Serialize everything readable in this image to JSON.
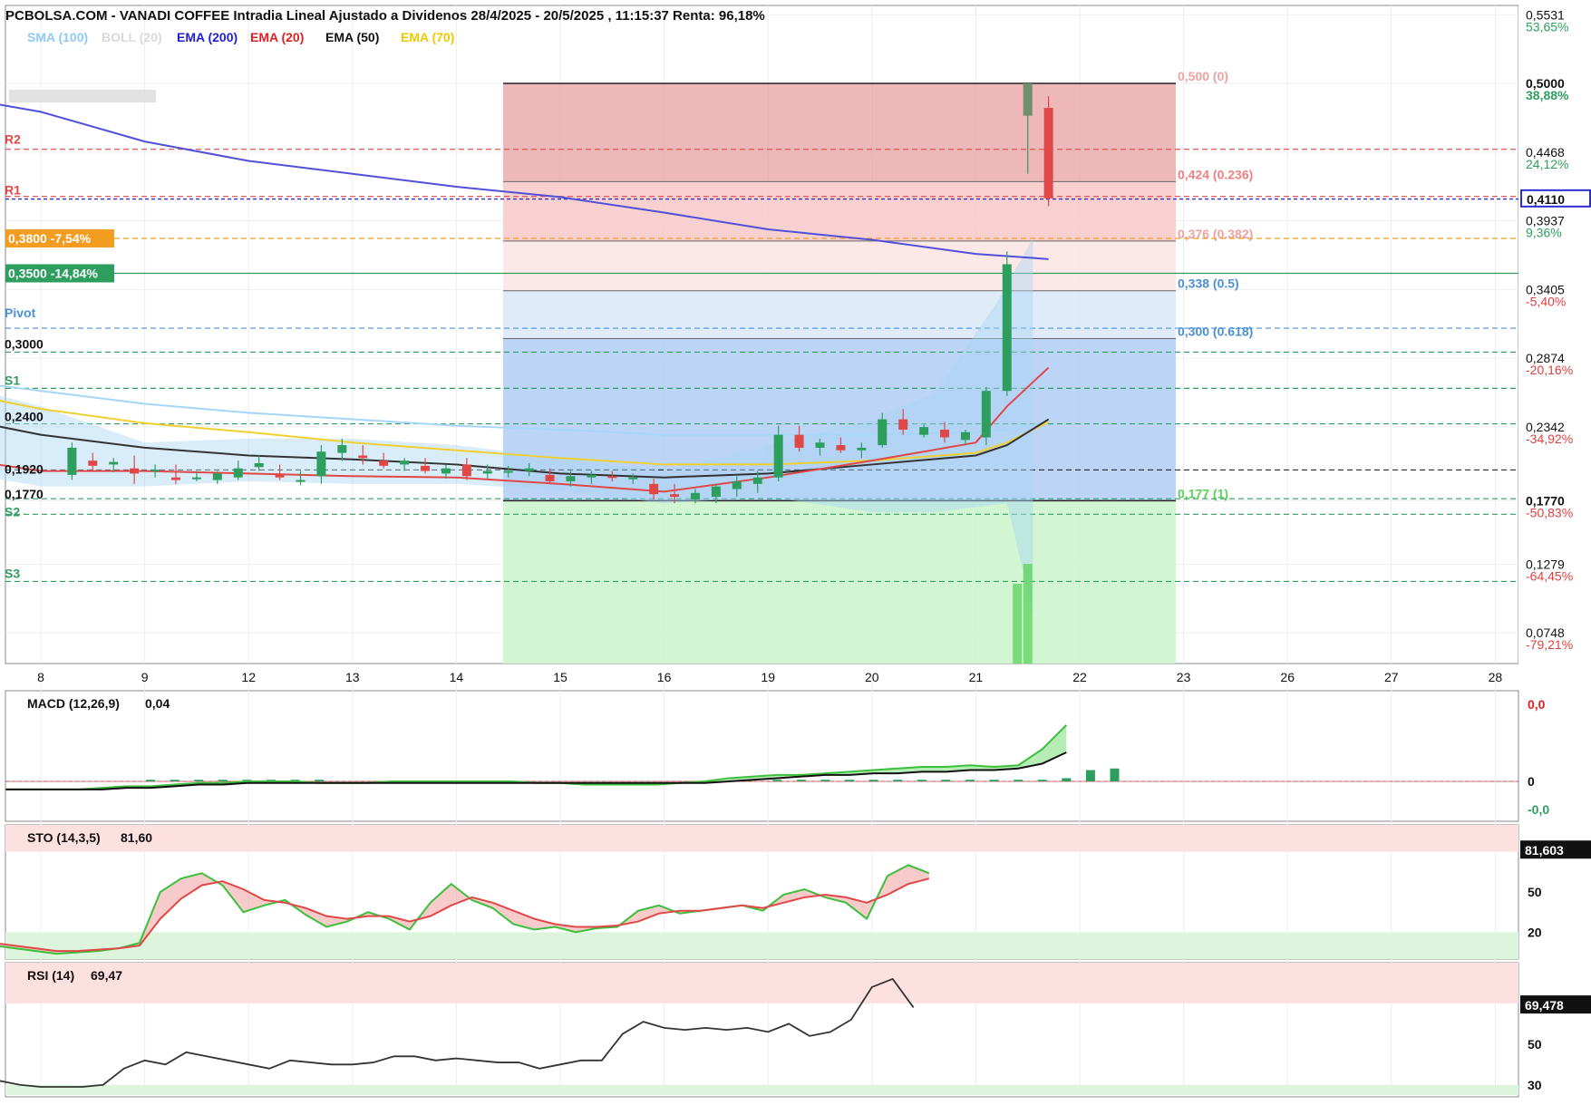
{
  "header": {
    "title": "PCBOLSA.COM - VANADI COFFEE Intradia Lineal Ajustado a Dividenos 28/4/2025 - 20/5/2025 , 11:15:37 Renta: 96,18%",
    "legend": [
      {
        "label": "SMA (100)",
        "color": "#8ec9f5"
      },
      {
        "label": "BOLL (20)",
        "color": "#d8d8d8"
      },
      {
        "label": "EMA (200)",
        "color": "#1f1fd8"
      },
      {
        "label": "EMA (20)",
        "color": "#e02020"
      },
      {
        "label": "EMA (50)",
        "color": "#111111"
      },
      {
        "label": "EMA (70)",
        "color": "#f0c800"
      }
    ]
  },
  "price_axis": {
    "ticks": [
      "0,5531",
      "0,5000",
      "0,4468",
      "0,3937",
      "0,3405",
      "0,2874",
      "0,2342",
      "0,1770",
      "0,1279",
      "0,0748"
    ],
    "ticks_num": [
      0.5531,
      0.5,
      0.4468,
      0.3937,
      0.3405,
      0.2874,
      0.2342,
      0.177,
      0.1279,
      0.0748
    ],
    "percents": [
      "53,65%",
      "38,88%",
      "24,12%",
      "9,36%",
      "-5,40%",
      "-20,16%",
      "-34,92%",
      "-50,83%",
      "-64,45%",
      "-79,21%"
    ],
    "percent_colors": [
      "#2e9e5e",
      "#2e9e5e",
      "#2e9e5e",
      "#2e9e5e",
      "#e04040",
      "#e04040",
      "#e04040",
      "#e04040",
      "#e04040",
      "#e04040"
    ],
    "current_price": "0,4110",
    "current_value": 0.411,
    "range": [
      0.04,
      0.575
    ]
  },
  "x_axis": {
    "labels": [
      "8",
      "9",
      "12",
      "13",
      "14",
      "15",
      "16",
      "19",
      "20",
      "21",
      "22",
      "23",
      "26",
      "27",
      "28"
    ]
  },
  "levels": {
    "r2": {
      "label": "R2",
      "value": 0.449
    },
    "r1": {
      "label": "R1",
      "value": 0.4125
    },
    "pivot": {
      "label": "Pivot",
      "value": 0.3105
    },
    "pivot_value": {
      "label": "0,3000",
      "value": 0.292
    },
    "s1": {
      "label": "S1",
      "value": 0.264
    },
    "s1_value": {
      "label": "0,2400",
      "value": 0.2365
    },
    "s2": {
      "label": "S2",
      "value": 0.1665
    },
    "s2_value": {
      "label": "0,1770",
      "value": 0.1785
    },
    "s3": {
      "label": "S3",
      "value": 0.1145
    },
    "left_0192": {
      "label": "0,1920",
      "value": 0.2065
    }
  },
  "alerts": [
    {
      "label": "0,3800 -7,54%",
      "value": 0.38,
      "color": "#f39c1f"
    },
    {
      "label": "0,3500 -14,84%",
      "value": 0.353,
      "color": "#2e9e5e"
    }
  ],
  "fibonacci": {
    "levels": [
      {
        "label": "0,500 (0)",
        "value": 0.5,
        "color": "#f0a0a0"
      },
      {
        "label": "0,424 (0.236)",
        "value": 0.424,
        "color": "#f08080"
      },
      {
        "label": "0,376 (0.382)",
        "value": 0.378,
        "color": "#f0a0a0"
      },
      {
        "label": "0,338 (0.5)",
        "value": 0.3395,
        "color": "#4a90d9"
      },
      {
        "label": "0,300 (0.618)",
        "value": 0.3025,
        "color": "#4a90d9"
      },
      {
        "label": "0,177 (1)",
        "value": 0.177,
        "color": "#5ad35a"
      }
    ]
  },
  "indicators": {
    "macd": {
      "title": "MACD (12,26,9)",
      "value": "0,04",
      "ticks": [
        "0,0",
        "0",
        "-0,0"
      ],
      "tick_colors": [
        "#e02020",
        "#111111",
        "#2e9e5e"
      ]
    },
    "sto": {
      "title": "STO (14,3,5)",
      "value": "81,60",
      "current": "81,603",
      "current_value": 81.603,
      "ticks": [
        "50",
        "20"
      ],
      "ticks_num": [
        50,
        20
      ]
    },
    "rsi": {
      "title": "RSI (14)",
      "value": "69,47",
      "current": "69,478",
      "current_value": 69.478,
      "ticks": [
        "50",
        "30"
      ],
      "ticks_num": [
        50,
        30
      ]
    }
  },
  "chart_data": {
    "type": "candlestick",
    "title": "PCBOLSA.COM - VANADI COFFEE Intradia Lineal Ajustado a Dividenos 28/4/2025 - 20/5/2025 , 11:15:37 Renta: 96,18%",
    "ylim": [
      0.04,
      0.575
    ],
    "candles": [
      {
        "x": 0.3,
        "o": 0.197,
        "h": 0.222,
        "l": 0.193,
        "c": 0.218
      },
      {
        "x": 0.5,
        "o": 0.208,
        "h": 0.214,
        "l": 0.2,
        "c": 0.204
      },
      {
        "x": 0.7,
        "o": 0.205,
        "h": 0.21,
        "l": 0.199,
        "c": 0.207
      },
      {
        "x": 0.9,
        "o": 0.202,
        "h": 0.212,
        "l": 0.19,
        "c": 0.198
      },
      {
        "x": 1.1,
        "o": 0.2,
        "h": 0.205,
        "l": 0.195,
        "c": 0.201
      },
      {
        "x": 1.3,
        "o": 0.195,
        "h": 0.205,
        "l": 0.19,
        "c": 0.193
      },
      {
        "x": 1.5,
        "o": 0.194,
        "h": 0.2,
        "l": 0.192,
        "c": 0.195
      },
      {
        "x": 1.7,
        "o": 0.193,
        "h": 0.2,
        "l": 0.19,
        "c": 0.198
      },
      {
        "x": 1.9,
        "o": 0.195,
        "h": 0.208,
        "l": 0.193,
        "c": 0.202
      },
      {
        "x": 2.1,
        "o": 0.203,
        "h": 0.212,
        "l": 0.2,
        "c": 0.206
      },
      {
        "x": 2.3,
        "o": 0.198,
        "h": 0.205,
        "l": 0.193,
        "c": 0.195
      },
      {
        "x": 2.5,
        "o": 0.192,
        "h": 0.2,
        "l": 0.189,
        "c": 0.193
      },
      {
        "x": 2.7,
        "o": 0.196,
        "h": 0.22,
        "l": 0.19,
        "c": 0.215
      },
      {
        "x": 2.9,
        "o": 0.214,
        "h": 0.225,
        "l": 0.208,
        "c": 0.22
      },
      {
        "x": 3.1,
        "o": 0.212,
        "h": 0.22,
        "l": 0.205,
        "c": 0.21
      },
      {
        "x": 3.3,
        "o": 0.208,
        "h": 0.214,
        "l": 0.202,
        "c": 0.204
      },
      {
        "x": 3.5,
        "o": 0.205,
        "h": 0.21,
        "l": 0.2,
        "c": 0.208
      },
      {
        "x": 3.7,
        "o": 0.204,
        "h": 0.21,
        "l": 0.198,
        "c": 0.2
      },
      {
        "x": 3.9,
        "o": 0.198,
        "h": 0.205,
        "l": 0.194,
        "c": 0.202
      },
      {
        "x": 4.1,
        "o": 0.205,
        "h": 0.21,
        "l": 0.193,
        "c": 0.196
      },
      {
        "x": 4.3,
        "o": 0.198,
        "h": 0.205,
        "l": 0.194,
        "c": 0.2
      },
      {
        "x": 4.5,
        "o": 0.199,
        "h": 0.204,
        "l": 0.195,
        "c": 0.2
      },
      {
        "x": 4.7,
        "o": 0.2,
        "h": 0.206,
        "l": 0.196,
        "c": 0.202
      },
      {
        "x": 4.9,
        "o": 0.197,
        "h": 0.202,
        "l": 0.19,
        "c": 0.192
      },
      {
        "x": 5.1,
        "o": 0.192,
        "h": 0.2,
        "l": 0.188,
        "c": 0.196
      },
      {
        "x": 5.3,
        "o": 0.195,
        "h": 0.2,
        "l": 0.19,
        "c": 0.197
      },
      {
        "x": 5.5,
        "o": 0.196,
        "h": 0.2,
        "l": 0.192,
        "c": 0.195
      },
      {
        "x": 5.7,
        "o": 0.194,
        "h": 0.198,
        "l": 0.19,
        "c": 0.195
      },
      {
        "x": 5.9,
        "o": 0.19,
        "h": 0.194,
        "l": 0.178,
        "c": 0.182
      },
      {
        "x": 6.1,
        "o": 0.182,
        "h": 0.19,
        "l": 0.175,
        "c": 0.18
      },
      {
        "x": 6.3,
        "o": 0.178,
        "h": 0.186,
        "l": 0.175,
        "c": 0.183
      },
      {
        "x": 6.5,
        "o": 0.18,
        "h": 0.19,
        "l": 0.175,
        "c": 0.188
      },
      {
        "x": 6.7,
        "o": 0.186,
        "h": 0.196,
        "l": 0.18,
        "c": 0.192
      },
      {
        "x": 6.9,
        "o": 0.19,
        "h": 0.2,
        "l": 0.183,
        "c": 0.195
      },
      {
        "x": 7.1,
        "o": 0.195,
        "h": 0.235,
        "l": 0.192,
        "c": 0.228
      },
      {
        "x": 7.3,
        "o": 0.228,
        "h": 0.235,
        "l": 0.215,
        "c": 0.218
      },
      {
        "x": 7.5,
        "o": 0.218,
        "h": 0.225,
        "l": 0.212,
        "c": 0.222
      },
      {
        "x": 7.7,
        "o": 0.22,
        "h": 0.226,
        "l": 0.214,
        "c": 0.216
      },
      {
        "x": 7.9,
        "o": 0.216,
        "h": 0.222,
        "l": 0.21,
        "c": 0.218
      },
      {
        "x": 8.1,
        "o": 0.22,
        "h": 0.245,
        "l": 0.218,
        "c": 0.24
      },
      {
        "x": 8.3,
        "o": 0.24,
        "h": 0.248,
        "l": 0.228,
        "c": 0.232
      },
      {
        "x": 8.5,
        "o": 0.228,
        "h": 0.236,
        "l": 0.226,
        "c": 0.234
      },
      {
        "x": 8.7,
        "o": 0.232,
        "h": 0.238,
        "l": 0.222,
        "c": 0.226
      },
      {
        "x": 8.9,
        "o": 0.224,
        "h": 0.232,
        "l": 0.22,
        "c": 0.23
      },
      {
        "x": 9.1,
        "o": 0.226,
        "h": 0.265,
        "l": 0.22,
        "c": 0.262
      },
      {
        "x": 9.3,
        "o": 0.262,
        "h": 0.37,
        "l": 0.258,
        "c": 0.36
      },
      {
        "x": 9.5,
        "o": 0.475,
        "h": 0.5,
        "l": 0.43,
        "c": 0.5
      },
      {
        "x": 9.7,
        "o": 0.481,
        "h": 0.49,
        "l": 0.405,
        "c": 0.411
      }
    ],
    "ema200": [
      [
        -1.2,
        0.5
      ],
      [
        -1.0,
        0.492
      ],
      [
        0.0,
        0.478
      ],
      [
        1.0,
        0.455
      ],
      [
        2.0,
        0.44
      ],
      [
        3.0,
        0.43
      ],
      [
        4.0,
        0.42
      ],
      [
        5.0,
        0.412
      ],
      [
        6.0,
        0.4
      ],
      [
        7.0,
        0.387
      ],
      [
        8.0,
        0.379
      ],
      [
        9.0,
        0.368
      ],
      [
        9.7,
        0.364
      ]
    ],
    "ema20": [
      [
        -1.2,
        0.222
      ],
      [
        -0.5,
        0.206
      ],
      [
        0,
        0.2
      ],
      [
        1,
        0.2
      ],
      [
        2,
        0.198
      ],
      [
        3,
        0.196
      ],
      [
        4,
        0.195
      ],
      [
        5,
        0.19
      ],
      [
        6,
        0.184
      ],
      [
        7,
        0.195
      ],
      [
        8,
        0.208
      ],
      [
        9,
        0.222
      ],
      [
        9.3,
        0.25
      ],
      [
        9.7,
        0.28
      ]
    ],
    "ema50": [
      [
        -1.2,
        0.24
      ],
      [
        -0.5,
        0.236
      ],
      [
        0,
        0.228
      ],
      [
        1,
        0.218
      ],
      [
        2,
        0.212
      ],
      [
        3,
        0.209
      ],
      [
        4,
        0.205
      ],
      [
        5,
        0.198
      ],
      [
        6,
        0.195
      ],
      [
        7,
        0.198
      ],
      [
        8,
        0.205
      ],
      [
        9,
        0.212
      ],
      [
        9.3,
        0.22
      ],
      [
        9.7,
        0.24
      ]
    ],
    "ema70": [
      [
        -1.2,
        0.262
      ],
      [
        -0.5,
        0.256
      ],
      [
        0,
        0.248
      ],
      [
        1,
        0.237
      ],
      [
        2,
        0.23
      ],
      [
        3,
        0.222
      ],
      [
        4,
        0.216
      ],
      [
        5,
        0.21
      ],
      [
        6,
        0.205
      ],
      [
        7,
        0.205
      ],
      [
        8,
        0.208
      ],
      [
        9,
        0.214
      ],
      [
        9.3,
        0.222
      ],
      [
        9.7,
        0.238
      ]
    ],
    "sma100": [
      [
        -1.2,
        0.27
      ],
      [
        -0.5,
        0.267
      ],
      [
        0,
        0.262
      ],
      [
        1,
        0.252
      ],
      [
        2,
        0.245
      ],
      [
        3,
        0.24
      ],
      [
        4,
        0.235
      ],
      [
        5,
        0.232
      ],
      [
        6,
        0.228
      ],
      [
        7,
        0.228
      ],
      [
        8,
        0.228
      ],
      [
        9,
        0.23
      ],
      [
        9.3,
        0.232
      ],
      [
        9.7,
        0.238
      ]
    ],
    "volume": [
      {
        "x": 9.4,
        "v": 0.8
      },
      {
        "x": 9.5,
        "v": 1.0
      }
    ],
    "x_categories": [
      "8",
      "9",
      "12",
      "13",
      "14",
      "15",
      "16",
      "19",
      "20",
      "21",
      "22",
      "23",
      "26",
      "27",
      "28"
    ],
    "macd": {
      "hist": [
        0.0,
        0.0,
        0.0,
        0.0,
        0.0,
        0.0,
        0.01,
        0.01,
        0.01,
        0.01,
        0.01,
        0.01,
        0.01,
        0.01,
        0.0,
        0.0,
        0.0,
        0.0,
        0.0,
        0.0,
        0.0,
        0.0,
        0.0,
        0.0,
        0.0,
        0.0,
        0.0,
        0.0,
        0.0,
        0.0,
        0.0,
        0.0,
        0.01,
        0.01,
        0.01,
        0.01,
        0.01,
        0.01,
        0.01,
        0.01,
        0.01,
        0.01,
        0.01,
        0.01,
        0.02,
        0.07,
        0.08
      ],
      "macd": [
        -0.05,
        -0.05,
        -0.05,
        -0.05,
        -0.04,
        -0.03,
        -0.03,
        -0.02,
        -0.01,
        -0.01,
        0.0,
        0.0,
        0.0,
        -0.01,
        -0.01,
        -0.01,
        0.0,
        0.0,
        0.0,
        0.0,
        0.0,
        0.0,
        -0.01,
        -0.01,
        -0.02,
        -0.02,
        -0.02,
        -0.02,
        -0.01,
        0.0,
        0.02,
        0.03,
        0.04,
        0.04,
        0.05,
        0.06,
        0.07,
        0.08,
        0.09,
        0.09,
        0.1,
        0.09,
        0.1,
        0.2,
        0.35
      ],
      "signal": [
        -0.05,
        -0.05,
        -0.05,
        -0.05,
        -0.05,
        -0.04,
        -0.04,
        -0.03,
        -0.02,
        -0.02,
        -0.01,
        -0.01,
        -0.01,
        -0.01,
        -0.01,
        -0.01,
        -0.01,
        -0.01,
        -0.01,
        -0.01,
        -0.01,
        -0.01,
        -0.01,
        -0.01,
        -0.01,
        -0.01,
        -0.01,
        -0.01,
        -0.01,
        -0.01,
        0.0,
        0.01,
        0.02,
        0.03,
        0.04,
        0.04,
        0.05,
        0.05,
        0.06,
        0.06,
        0.07,
        0.07,
        0.08,
        0.11,
        0.18
      ],
      "ylim": [
        -0.08,
        0.45
      ]
    },
    "sto": {
      "k": [
        25,
        12,
        10,
        8,
        6,
        4,
        5,
        6,
        8,
        12,
        50,
        60,
        64,
        55,
        35,
        40,
        44,
        33,
        24,
        28,
        35,
        30,
        22,
        42,
        56,
        44,
        38,
        26,
        22,
        24,
        20,
        23,
        24,
        36,
        40,
        34,
        36,
        38,
        40,
        36,
        48,
        52,
        46,
        42,
        30,
        62,
        70,
        64
      ],
      "d": [
        15,
        14,
        12,
        10,
        8,
        6,
        6,
        7,
        8,
        10,
        30,
        45,
        55,
        58,
        52,
        44,
        42,
        38,
        32,
        30,
        32,
        32,
        28,
        32,
        40,
        46,
        42,
        36,
        30,
        26,
        24,
        24,
        25,
        28,
        34,
        36,
        36,
        38,
        40,
        38,
        42,
        46,
        48,
        46,
        42,
        48,
        56,
        60
      ],
      "ylim": [
        0,
        100
      ]
    },
    "rsi": {
      "values": [
        35,
        31,
        32,
        30,
        29,
        29,
        29,
        30,
        38,
        42,
        40,
        46,
        44,
        42,
        40,
        38,
        42,
        41,
        40,
        40,
        41,
        44,
        44,
        42,
        43,
        42,
        41,
        41,
        38,
        40,
        42,
        42,
        55,
        61,
        58,
        57,
        58,
        57,
        58,
        56,
        60,
        54,
        56,
        62,
        78,
        82,
        68
      ],
      "ylim": [
        25,
        90
      ]
    }
  }
}
